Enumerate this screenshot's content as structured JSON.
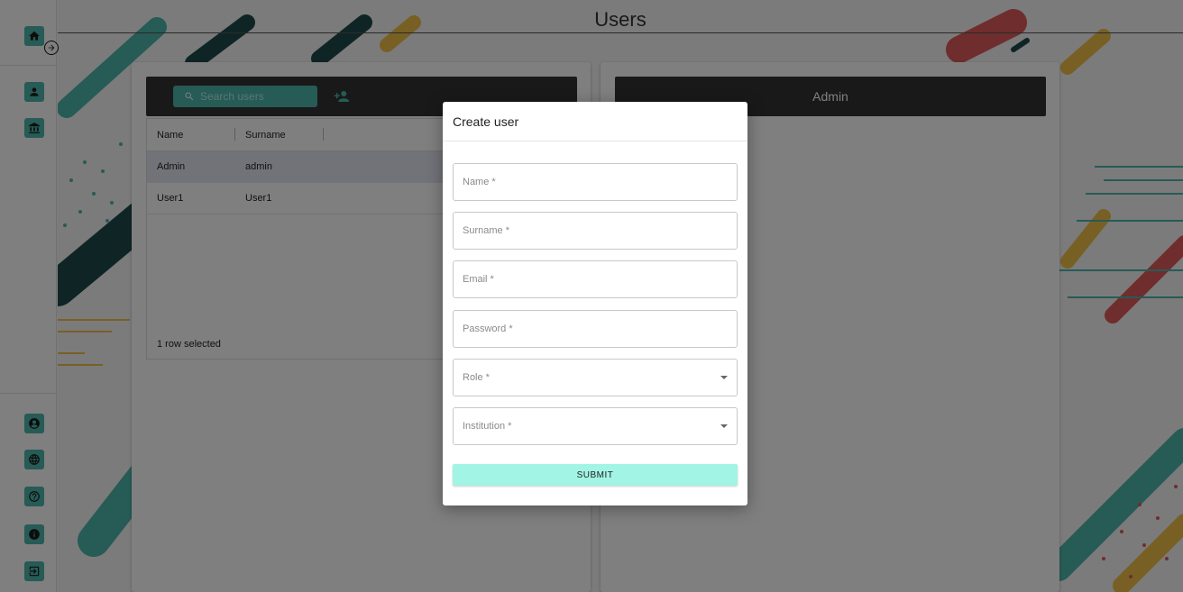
{
  "page": {
    "title": "Users"
  },
  "colors": {
    "accent": "#4db6ac",
    "submit_bg": "#a2f4e4",
    "toolbar_bg": "#333333",
    "overlay": "rgba(0,0,0,0.5)"
  },
  "sidebar": {
    "top_items": [
      {
        "icon": "home-icon"
      },
      {
        "icon": "person-icon"
      },
      {
        "icon": "institution-icon"
      }
    ],
    "expand_icon": "arrow-right-circle-icon",
    "bottom_items": [
      {
        "icon": "account-circle-icon"
      },
      {
        "icon": "globe-icon"
      },
      {
        "icon": "help-icon"
      },
      {
        "icon": "info-icon"
      },
      {
        "icon": "logout-icon"
      }
    ]
  },
  "users_panel": {
    "search_placeholder": "Search users",
    "search_icon": "search-icon",
    "add_user_icon": "add-user-icon",
    "columns": [
      "Name",
      "Surname"
    ],
    "rows": [
      {
        "name": "Admin",
        "surname": "admin",
        "selected": true
      },
      {
        "name": "User1",
        "surname": "User1",
        "selected": false
      }
    ],
    "footer": "1 row selected"
  },
  "detail_panel": {
    "header": "Admin"
  },
  "dialog": {
    "title": "Create user",
    "fields": {
      "name": "Name *",
      "surname": "Surname *",
      "email": "Email *",
      "password": "Password *",
      "role": "Role *",
      "institution": "Institution *"
    },
    "submit_label": "SUBMIT"
  }
}
